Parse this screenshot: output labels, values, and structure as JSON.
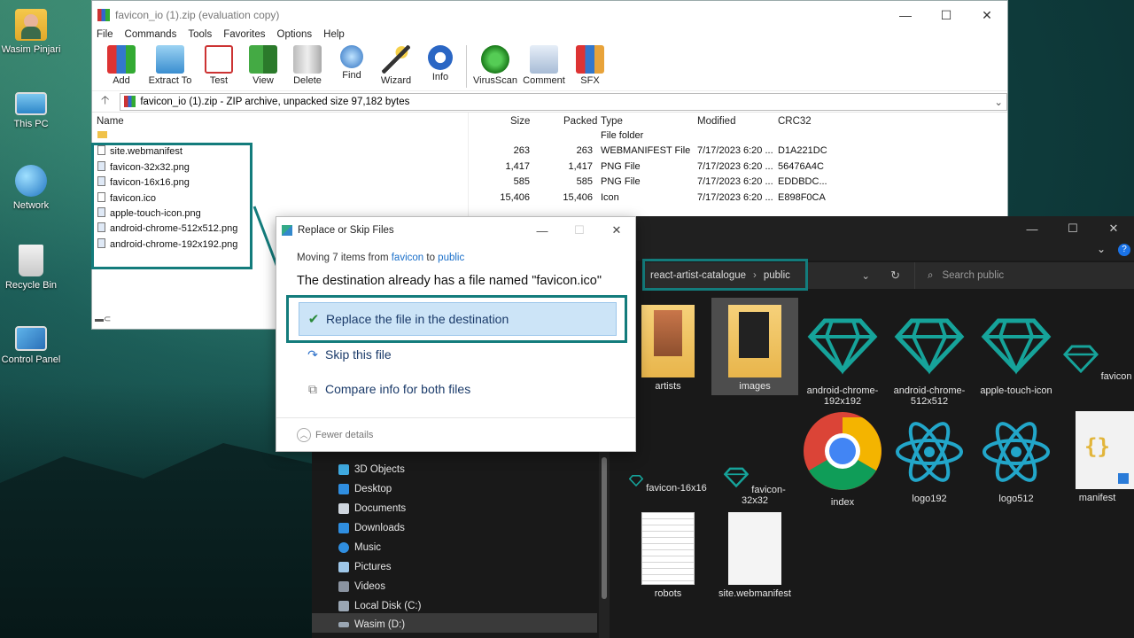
{
  "desktop": {
    "icons": [
      {
        "label": "Wasim Pinjari"
      },
      {
        "label": "This PC"
      },
      {
        "label": "Network"
      },
      {
        "label": "Recycle Bin"
      },
      {
        "label": "Control Panel"
      }
    ]
  },
  "winrar": {
    "title": "favicon_io (1).zip (evaluation copy)",
    "menu": [
      "File",
      "Commands",
      "Tools",
      "Favorites",
      "Options",
      "Help"
    ],
    "toolbar": [
      "Add",
      "Extract To",
      "Test",
      "View",
      "Delete",
      "Find",
      "Wizard",
      "Info",
      "VirusScan",
      "Comment",
      "SFX"
    ],
    "address": "favicon_io (1).zip - ZIP archive, unpacked size 97,182 bytes",
    "columns": {
      "name": "Name",
      "size": "Size",
      "packed": "Packed",
      "type": "Type",
      "modified": "Modified",
      "crc": "CRC32"
    },
    "rows": [
      {
        "name": "",
        "size": "",
        "packed": "",
        "type": "File folder",
        "modified": "",
        "crc": ""
      },
      {
        "name": "site.webmanifest",
        "size": "263",
        "packed": "263",
        "type": "WEBMANIFEST File",
        "modified": "7/17/2023 6:20 ...",
        "crc": "D1A221DC"
      },
      {
        "name": "favicon-32x32.png",
        "size": "1,417",
        "packed": "1,417",
        "type": "PNG File",
        "modified": "7/17/2023 6:20 ...",
        "crc": "56476A4C"
      },
      {
        "name": "favicon-16x16.png",
        "size": "585",
        "packed": "585",
        "type": "PNG File",
        "modified": "7/17/2023 6:20 ...",
        "crc": "EDDBDC..."
      },
      {
        "name": "favicon.ico",
        "size": "15,406",
        "packed": "15,406",
        "type": "Icon",
        "modified": "7/17/2023 6:20 ...",
        "crc": "E898F0CA"
      },
      {
        "name": "apple-touch-icon.png",
        "size": "",
        "packed": "",
        "type": "",
        "modified": "",
        "crc": ""
      },
      {
        "name": "android-chrome-512x512.png",
        "size": "",
        "packed": "",
        "type": "",
        "modified": "",
        "crc": ""
      },
      {
        "name": "android-chrome-192x192.png",
        "size": "",
        "packed": "",
        "type": "",
        "modified": "",
        "crc": ""
      }
    ]
  },
  "explorer": {
    "breadcrumb": [
      "react-artist-catalogue",
      "public"
    ],
    "search_placeholder": "Search public",
    "nav": [
      "3D Objects",
      "Desktop",
      "Documents",
      "Downloads",
      "Music",
      "Pictures",
      "Videos",
      "Local Disk (C:)",
      "Wasim (D:)"
    ],
    "files": [
      {
        "label": "artists"
      },
      {
        "label": "images"
      },
      {
        "label": "android-chrome-192x192"
      },
      {
        "label": "android-chrome-512x512"
      },
      {
        "label": "apple-touch-icon"
      },
      {
        "label": "favicon"
      },
      {
        "label": "favicon-16x16"
      },
      {
        "label": "favicon-32x32"
      },
      {
        "label": "index"
      },
      {
        "label": "logo192"
      },
      {
        "label": "logo512"
      },
      {
        "label": "manifest"
      },
      {
        "label": "robots"
      },
      {
        "label": "site.webmanifest"
      }
    ]
  },
  "dialog": {
    "title": "Replace or Skip Files",
    "moving_prefix": "Moving 7 items from",
    "from": "favicon",
    "to_word": "to",
    "to": "public",
    "message": "The destination already has a file named \"favicon.ico\"",
    "options": [
      "Replace the file in the destination",
      "Skip this file",
      "Compare info for both files"
    ],
    "fewer_details": "Fewer details"
  },
  "colors": {
    "accent": "#137c7c",
    "highlight": "#cce4f7",
    "link": "#1a6fc9"
  }
}
